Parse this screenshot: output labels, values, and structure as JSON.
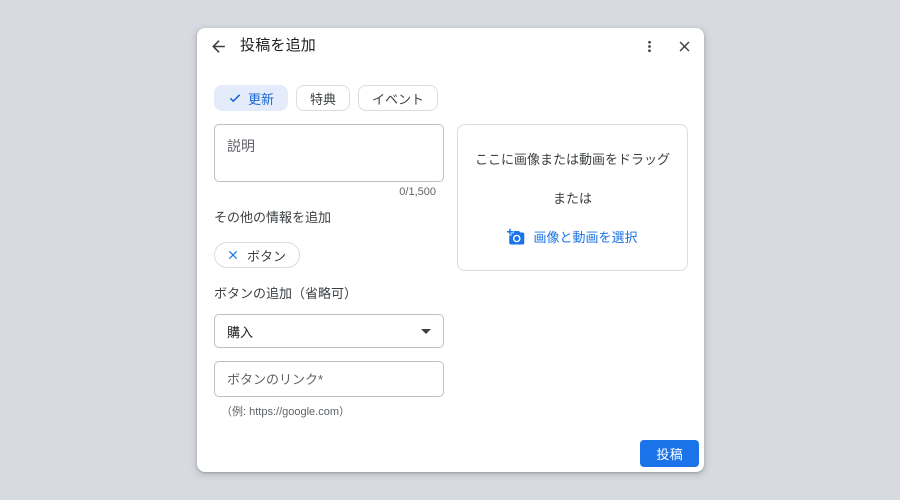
{
  "page": {
    "background_color": "#d7dae0"
  },
  "dialog": {
    "title": "投稿を追加",
    "icons": {
      "back": "arrow-left",
      "more": "kebab-vertical-dots",
      "close": "x-mark",
      "selected_check": "checkmark",
      "remove_chip": "x-mark",
      "select_caret": "caret-down",
      "add_photo": "camera-plus"
    },
    "post_type_chips": [
      {
        "label": "更新",
        "selected": true
      },
      {
        "label": "特典",
        "selected": false
      },
      {
        "label": "イベント",
        "selected": false
      }
    ],
    "description": {
      "placeholder": "説明",
      "value": "",
      "counter": "0/1,500"
    },
    "more_info_label": "その他の情報を追加",
    "added_button_chip": {
      "label": "ボタン"
    },
    "button_section_label": "ボタンの追加（省略可）",
    "button_type_select": {
      "value": "購入"
    },
    "button_link_input": {
      "placeholder": "ボタンのリンク*",
      "value": "",
      "helper": "（例: https://google.com）"
    },
    "media_upload": {
      "drag_text": "ここに画像または動画をドラッグ",
      "or_text": "または",
      "select_button_label": "画像と動画を選択"
    },
    "submit_label": "投稿",
    "colors": {
      "accent_blue": "#1a73e8",
      "selected_chip_bg": "#e4ebfa",
      "selected_chip_text": "#1a67d2",
      "text_primary": "#202124",
      "text_secondary": "#5f6368",
      "border_light": "#dadce0",
      "border_input": "#bdc1c6",
      "submit_bg": "#1a73e8"
    }
  }
}
